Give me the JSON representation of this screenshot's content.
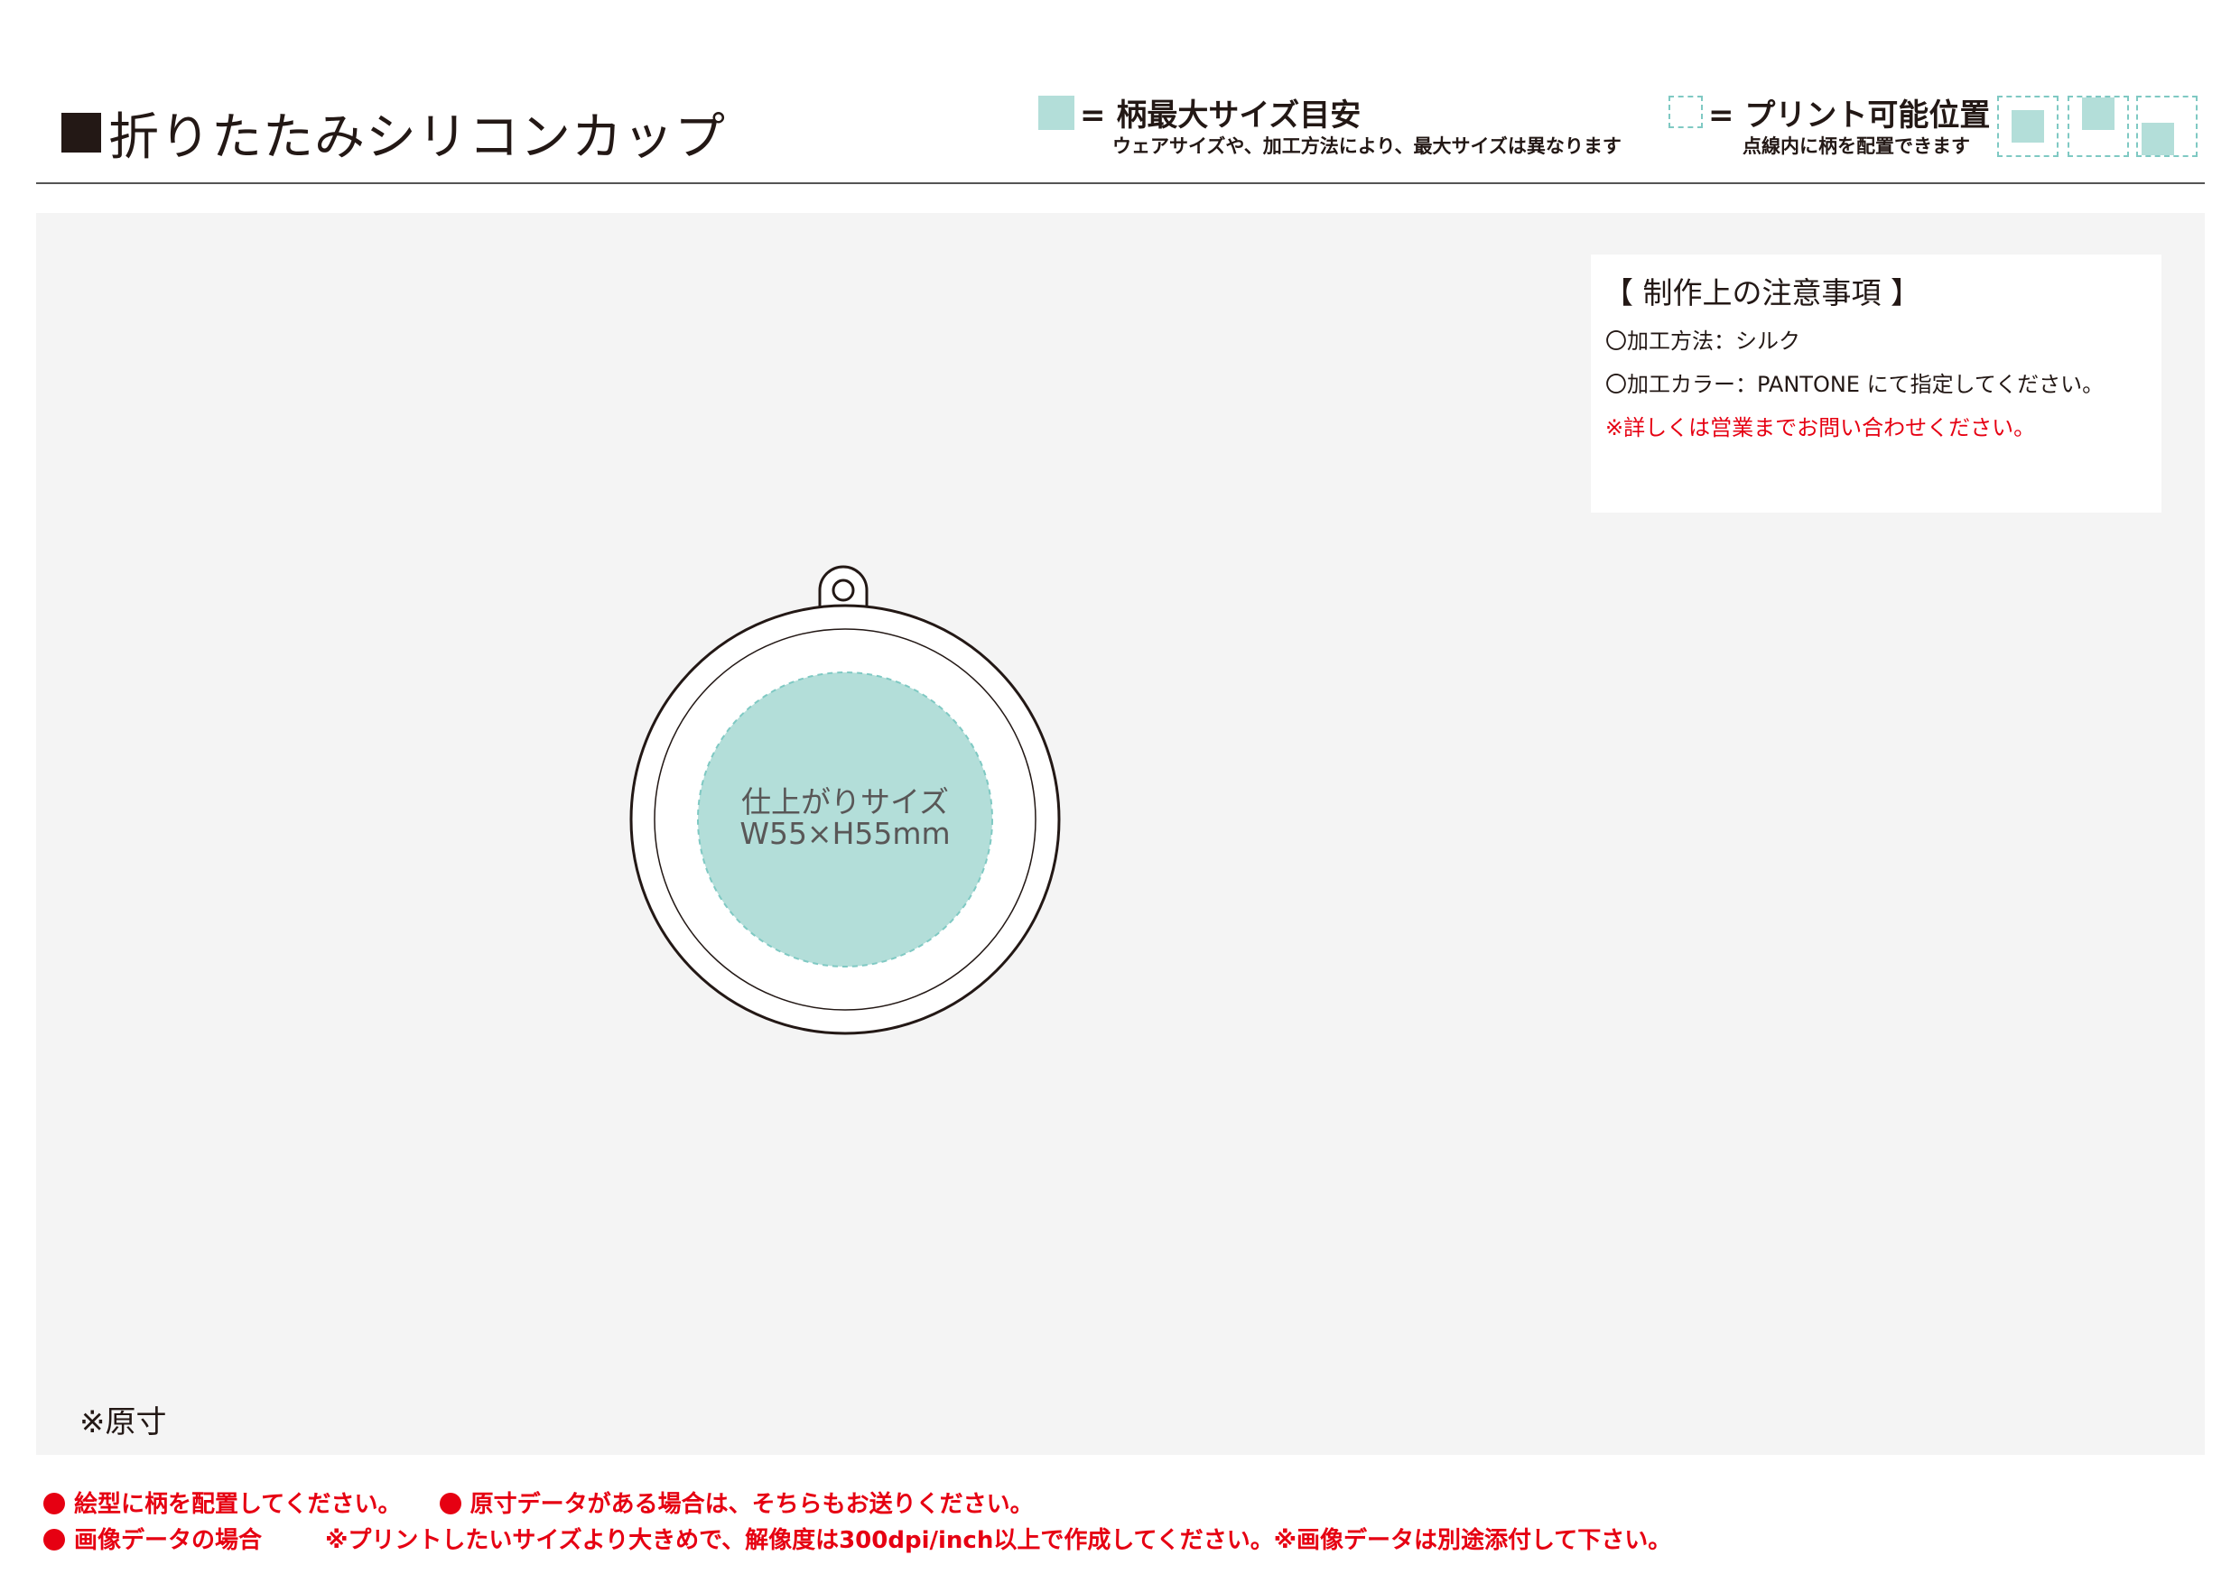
{
  "header": {
    "title": "折りたたみシリコンカップ",
    "legend_max": {
      "label": "= 柄最大サイズ目安",
      "note": "ウェアサイズや、加工方法により、最大サイズは異なります"
    },
    "legend_print": {
      "label": "= プリント可能位置",
      "note": "点線内に柄を配置できます"
    }
  },
  "notes": {
    "title": "【 制作上の注意事項 】",
    "method": "〇加工方法：シルク",
    "color": "〇加工カラー：PANTONE にて指定してください。",
    "contact": "※詳しくは営業までお問い合わせください。"
  },
  "template": {
    "size_label_1": "仕上がりサイズ",
    "size_label_2": "W55×H55mm",
    "scale_note": "※原寸"
  },
  "footer": {
    "line1_a": "絵型に柄を配置してください。",
    "line1_b": "原寸データがある場合は、そちらもお送りください。",
    "line2_a": "画像データの場合",
    "line2_b": "※プリントしたいサイズより大きめで、解像度は300dpi/inch以上で作成してください。※画像データは別途添付して下さい。"
  },
  "colors": {
    "print_area": "#b3ded9",
    "print_area_dash": "#7fc9c3",
    "accent_red": "#e60012",
    "background_gray": "#f4f4f4"
  }
}
